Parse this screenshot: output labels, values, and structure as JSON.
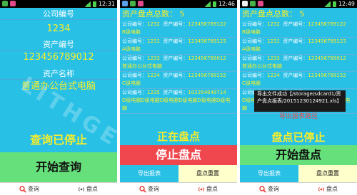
{
  "status": {
    "time1": "12:31",
    "time2": "12:46",
    "time3": "12:49"
  },
  "screen1": {
    "company_label": "公司编号",
    "company_value": "1234",
    "asset_no_label": "资产编号",
    "asset_no_value": "123456789012",
    "asset_name_label": "资产名称",
    "asset_name_value": "普通办公台式电脑",
    "status_text": "查询已停止",
    "start_button": "开始查询"
  },
  "list": {
    "count_label": "资产盘点总数：",
    "count_value": "5",
    "company_label": "公司编号：",
    "asset_label": "资产编号：",
    "records": [
      {
        "company": "1232",
        "asset": "123456789122",
        "name": "B级电脑"
      },
      {
        "company": "1231",
        "asset": "123456789123",
        "name": "A级电脑"
      },
      {
        "company": "1233",
        "asset": "123456789012",
        "name": "普通办公台式电脑"
      },
      {
        "company": "1234",
        "asset": "123456789152",
        "name": "C级电脑"
      },
      {
        "company": "1235",
        "asset": "102354649714",
        "name": "D级电脑D级电脑D级电脑D级电脑D级电脑D级电脑"
      }
    ]
  },
  "screen2": {
    "status_text": "正在盘点",
    "stop_button": "停止盘点",
    "export_button": "导出报表",
    "reset_button": "盘点重置"
  },
  "screen3": {
    "status_text": "盘点已停止",
    "start_button": "开始盘点",
    "toast": "导出文件成功【/storage/sdcard1/资产盘点报表/20151230124921.xls】",
    "export_path_label": "导出报表路径"
  },
  "nav": {
    "query": "查询",
    "inventory": "盘点"
  },
  "watermark": "LITHGE"
}
